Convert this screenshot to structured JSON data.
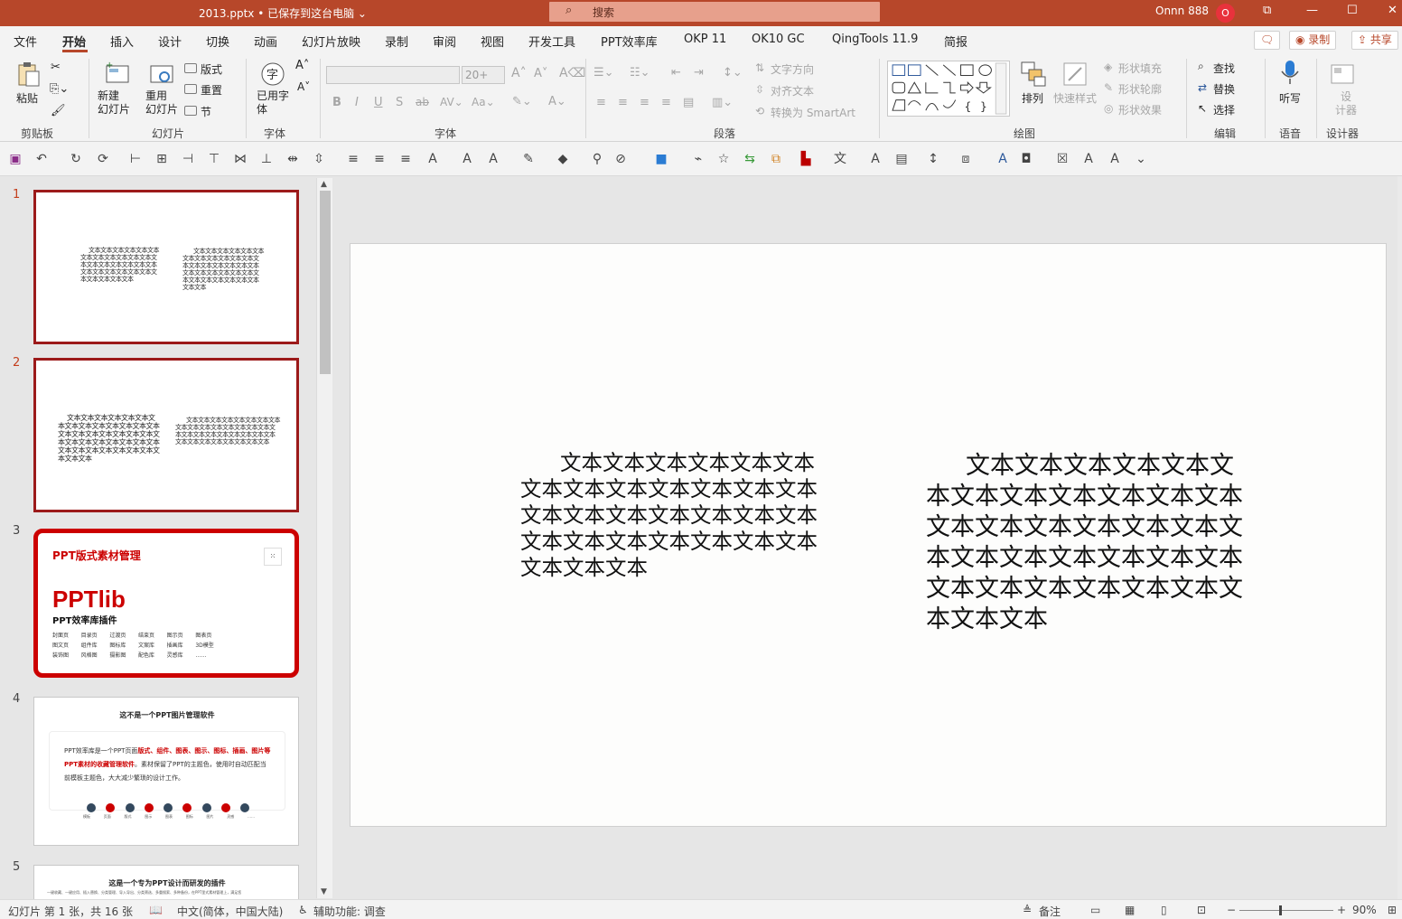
{
  "titlebar": {
    "doc_title": "2013.pptx • 已保存到这台电脑 ⌄",
    "search_placeholder": "搜索",
    "user_name": "Onnn 888",
    "avatar_initial": "O",
    "min": "—",
    "restore": "☐",
    "close": "✕",
    "ribbon_display": "⧉"
  },
  "tabs": [
    "文件",
    "开始",
    "插入",
    "设计",
    "切换",
    "动画",
    "幻灯片放映",
    "录制",
    "审阅",
    "视图",
    "开发工具",
    "PPT效率库",
    "OKP 11",
    "OK10 GC",
    "QingTools 11.9",
    "简报"
  ],
  "tab_actions": {
    "comment": "🗨",
    "record": "◉ 录制",
    "share": "⇪ 共享"
  },
  "ribbon": {
    "clipboard": {
      "paste": "粘贴",
      "label": "剪贴板"
    },
    "slides": {
      "new_slide": "新建\n幻灯片",
      "reuse": "重用\n幻灯片",
      "layout": "版式",
      "reset": "重置",
      "section": "节",
      "label": "幻灯片"
    },
    "font_group_a": {
      "used_font": "已用字\n体",
      "label": "字体"
    },
    "font": {
      "size": "20+",
      "label": "字体"
    },
    "paragraph": {
      "text_direction": "文字方向",
      "align_text": "对齐文本",
      "smartart": "转换为 SmartArt",
      "label": "段落"
    },
    "drawing": {
      "arrange": "排列",
      "quick_styles": "快速样式",
      "fill": "形状填充",
      "outline": "形状轮廓",
      "effects": "形状效果",
      "label": "绘图"
    },
    "editing": {
      "find": "查找",
      "replace": "替换",
      "select": "选择",
      "label": "编辑"
    },
    "voice": {
      "dictate": "听写",
      "label": "语音"
    },
    "designer": {
      "designer": "设\n计器",
      "label": "设计器"
    }
  },
  "thumbnails": [
    {
      "num": "1",
      "selected": true
    },
    {
      "num": "2",
      "selected": false
    },
    {
      "num": "3",
      "selected": false
    },
    {
      "num": "4",
      "selected": false
    },
    {
      "num": "5",
      "selected": false
    }
  ],
  "thumb_text": {
    "t1_left": "文本文本文本文本文本文本文本文本文本文本文本文本文本文本文本文本文本文本文本文本文本文本文本文本文本文本文本文本文本文本",
    "t1_right": "文本文本文本文本文本文本文本文本文本文本文本文本文本文本文本文本文本文本文本文本文本文本文本文本文本文本文本文本文本文本文本文本文本文本",
    "t2_left": "文本文本文本文本文本文本文本文本文本文本文本文本文本文本文本文本文本文本文本文本文本文本文本文本文本文本文本文本文本文本文本文本文本文本文本文本文本文本文本",
    "t2_right": "文本文本文本文本文本文本文本文本文本文本文本文本文本文本文本文本文本文本文本文本文本文本文本文本文本文本文本文本文本文本文本文本文本",
    "t3_title": "PPT版式素材管理",
    "t3_brand": "PPTlib",
    "t3_sub": "PPT效率库插件",
    "t3_grid": [
      "封面页",
      "目录页",
      "过渡页",
      "结束页",
      "图示页",
      "图表页",
      "图文页",
      "组件库",
      "图标库",
      "文案库",
      "插画库",
      "3D模型",
      "装饰图",
      "风格图",
      "摄影图",
      "配色库",
      "灵感库",
      "……"
    ],
    "t4_title": "这不是一个PPT图片管理软件",
    "t4_body_a": "PPT效率库是一个PPT页面",
    "t4_body_red": "版式、组件、图表、图示、图标、插画、图片等PPT素材的收藏管理软件",
    "t4_body_b": "。素材保留了PPT的主题色，使用时自动匹配当前模板主题色，大大减少繁琐的设计工作。",
    "t4_icons": [
      "模板",
      "页面",
      "版式",
      "图示",
      "图表",
      "图标",
      "图片",
      "灵感",
      "……"
    ],
    "t5_title": "这是一个专为PPT设计而研发的插件",
    "t5_body": "一键收藏、一键应用、插入替换、分类管理、导入导出、分类筛选、多重搜索、多种备份，在PPT里式素材管理上，满足您"
  },
  "slide": {
    "left_text": "文本文本文本文本文本文本文本文本文本文本文本文本文本文本文本文本文本文本文本文本文本文本文本文本文本文本文本文本文本文本",
    "right_text": "文本文本文本文本文本文本文本文本文本文本文本文本文本文本文本文本文本文本文本文本文本文本文本文本文本文本文本文本文本文本文本文本文本文本"
  },
  "status": {
    "slide_count": "幻灯片 第 1 张，共 16 张",
    "language": "中文(简体，中国大陆)",
    "accessibility": "辅助功能: 调查",
    "notes": "备注",
    "zoom": "90%"
  },
  "colors": {
    "brand": "#b7472a",
    "selected_thumb_border": "#9c1a1a"
  }
}
